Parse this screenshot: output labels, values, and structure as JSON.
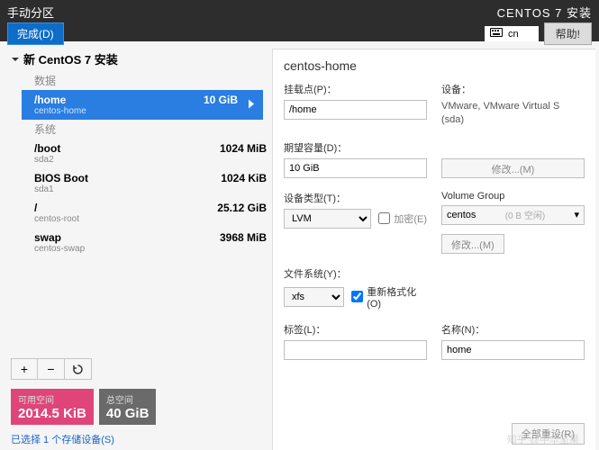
{
  "header": {
    "pageTitle": "手动分区",
    "doneLabel": "完成(D)",
    "installer": "CENTOS 7 安装",
    "langIndicator": "cn",
    "helpLabel": "帮助!"
  },
  "tree": {
    "rootLabel": "新 CentOS 7 安装",
    "sections": {
      "data": "数据",
      "system": "系统"
    },
    "items": [
      {
        "path": "/home",
        "size": "10 GiB",
        "source": "centos-home",
        "section": "data",
        "selected": true
      },
      {
        "path": "/boot",
        "size": "1024 MiB",
        "source": "sda2",
        "section": "system"
      },
      {
        "path": "BIOS Boot",
        "size": "1024 KiB",
        "source": "sda1",
        "section": "system"
      },
      {
        "path": "/",
        "size": "25.12 GiB",
        "source": "centos-root",
        "section": "system"
      },
      {
        "path": "swap",
        "size": "3968 MiB",
        "source": "centos-swap",
        "section": "system"
      }
    ]
  },
  "spaces": {
    "availLabel": "可用空间",
    "availValue": "2014.5 KiB",
    "totalLabel": "总空间",
    "totalValue": "40 GiB"
  },
  "storageLink": "已选择 1 个存储设备(S)",
  "details": {
    "title": "centos-home",
    "mountPointLabel": "挂载点(P)：",
    "mountPoint": "/home",
    "deviceLabel": "设备：",
    "deviceText": "VMware, VMware Virtual S (sda)",
    "desiredLabel": "期望容量(D)：",
    "desired": "10 GiB",
    "modifyBtn": "修改...(M)",
    "deviceTypeLabel": "设备类型(T)：",
    "deviceType": "LVM",
    "encryptLabel": "加密(E)",
    "vgLabel": "Volume Group",
    "vgName": "centos",
    "vgFree": "(0 B 空闲)",
    "fsLabel": "文件系统(Y)：",
    "fs": "xfs",
    "reformatLabel": "重新格式化(O)",
    "labelLabel": "标签(L)：",
    "labelValue": "",
    "nameLabel": "名称(N)：",
    "nameValue": "home",
    "resetAll": "全部重设(R)"
  },
  "watermark": "知乎 @中华坚果"
}
